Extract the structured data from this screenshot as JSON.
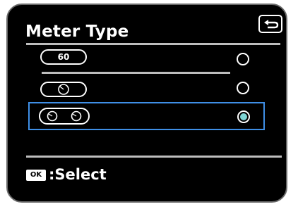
{
  "header": {
    "title": "Meter Type",
    "back_icon": "return-arrow-icon"
  },
  "options": [
    {
      "id": "numeric",
      "label": "60",
      "icon": "numeric-meter-icon",
      "selected": false
    },
    {
      "id": "analog",
      "label": "",
      "icon": "analog-dial-meter-icon",
      "selected": false
    },
    {
      "id": "dual-dial",
      "label": "",
      "icon": "dual-dial-meter-icon",
      "selected": true
    }
  ],
  "footer": {
    "button_label": "OK",
    "action_label": ":Select"
  },
  "colors": {
    "background": "#000000",
    "text": "#ffffff",
    "divider": "#bdbdbd",
    "focus_border": "#3f8fe6",
    "radio_fill": "#7fd6d6"
  }
}
